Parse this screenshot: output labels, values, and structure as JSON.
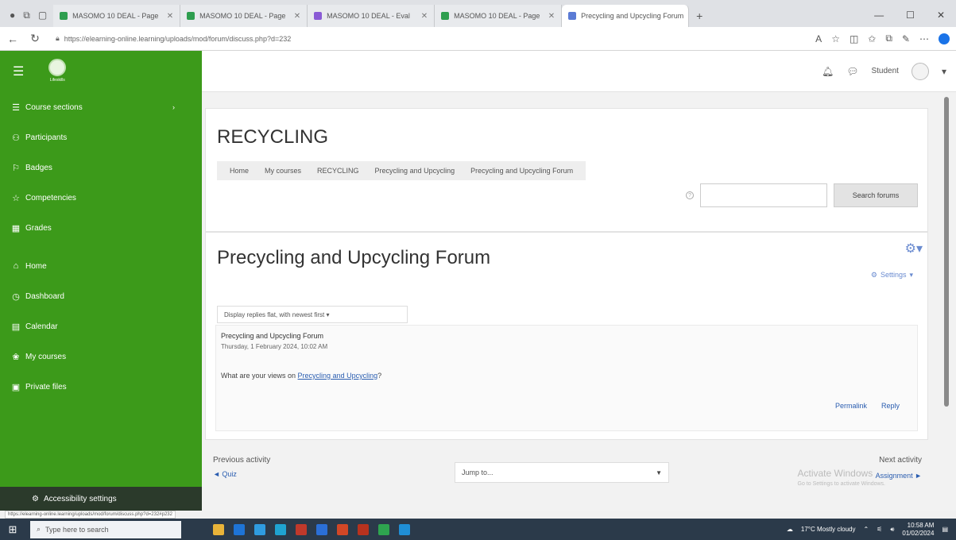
{
  "browser": {
    "tabs": [
      {
        "title": "MASOMO 10 DEAL - Page",
        "fav": "green"
      },
      {
        "title": "MASOMO 10 DEAL - Page",
        "fav": "green"
      },
      {
        "title": "MASOMO 10 DEAL - Eval",
        "fav": "purple"
      },
      {
        "title": "MASOMO 10 DEAL - Page",
        "fav": "green"
      },
      {
        "title": "Precycling and Upcycling Forum",
        "fav": "blue"
      }
    ],
    "url": "https://elearning-online.learning/uploads/mod/forum/discuss.php?d=232",
    "new_tab": "+",
    "win_min": "—",
    "win_max": "☐",
    "win_close": "✕"
  },
  "header": {
    "logo_caption": "Lifeskills",
    "username": "Student"
  },
  "sidebar": {
    "items": [
      {
        "icon": "☰",
        "label": "Course sections",
        "chev": "›"
      },
      {
        "icon": "⚇",
        "label": "Participants"
      },
      {
        "icon": "⚐",
        "label": "Badges"
      },
      {
        "icon": "☆",
        "label": "Competencies"
      },
      {
        "icon": "▦",
        "label": "Grades"
      },
      {
        "icon": "⌂",
        "label": "Home"
      },
      {
        "icon": "◷",
        "label": "Dashboard"
      },
      {
        "icon": "▤",
        "label": "Calendar"
      },
      {
        "icon": "❀",
        "label": "My courses"
      },
      {
        "icon": "▣",
        "label": "Private files"
      }
    ],
    "accessibility": "Accessibility settings"
  },
  "course": {
    "title": "RECYCLING",
    "breadcrumb": [
      "Home",
      "My courses",
      "RECYCLING",
      "Precycling and Upcycling",
      "Precycling and Upcycling Forum"
    ],
    "search_placeholder": "",
    "search_button": "Search forums"
  },
  "forum": {
    "title": "Precycling and Upcycling Forum",
    "settings_label": "Settings",
    "display_mode": "Display replies flat, with newest first",
    "post": {
      "subject": "Precycling and Upcycling Forum",
      "date": "Thursday, 1 February 2024, 10:02 AM",
      "body_prefix": "What are your views on ",
      "body_link": "Precycling and Upcycling",
      "body_suffix": "?",
      "permalink": "Permalink",
      "reply": "Reply"
    }
  },
  "activity_nav": {
    "previous_label": "Previous activity",
    "previous_link": "◄ Quiz",
    "jump_label": "Jump to...",
    "next_label": "Next activity",
    "next_link": "Assignment ►"
  },
  "watermark": {
    "title": "Activate Windows",
    "subtitle": "Go to Settings to activate Windows."
  },
  "status_url": "https://elearning-online.learning/uploads/mod/forum/discuss.php?d=232#p232",
  "taskbar": {
    "search_placeholder": "Type here to search",
    "weather": "17°C Mostly cloudy",
    "time": "10:58 AM",
    "date": "01/02/2024"
  },
  "colors": {
    "brand_green": "#3c9a1a",
    "link_blue": "#2a5db0"
  }
}
